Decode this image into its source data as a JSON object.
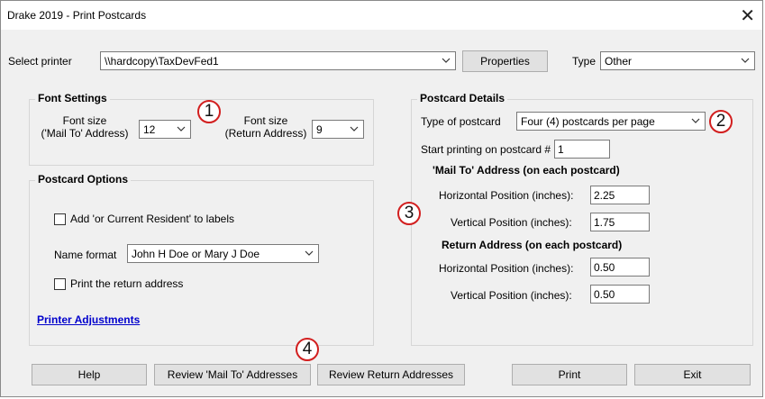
{
  "window": {
    "title": "Drake 2019 - Print Postcards",
    "close_glyph": "✕"
  },
  "printer": {
    "label": "Select printer",
    "value": "\\\\hardcopy\\TaxDevFed1",
    "properties_label": "Properties",
    "type_label": "Type",
    "type_value": "Other"
  },
  "font_settings": {
    "title": "Font Settings",
    "mail_to_label_line1": "Font size",
    "mail_to_label_line2": "('Mail To' Address)",
    "mail_to_value": "12",
    "return_label_line1": "Font size",
    "return_label_line2": "(Return Address)",
    "return_value": "9"
  },
  "postcard_options": {
    "title": "Postcard Options",
    "add_resident_label": "Add 'or Current Resident' to labels",
    "add_resident_checked": false,
    "name_format_label": "Name format",
    "name_format_value": "John H Doe or Mary J Doe",
    "print_return_label": "Print the return address",
    "print_return_checked": false,
    "printer_adjustments_link": "Printer Adjustments"
  },
  "postcard_details": {
    "title": "Postcard Details",
    "type_label": "Type of postcard",
    "type_value": "Four (4) postcards per page",
    "start_label": "Start printing on postcard #",
    "start_value": "1",
    "mail_to_heading": "'Mail To' Address (on each postcard)",
    "mail_to_h_label": "Horizontal Position (inches):",
    "mail_to_h_value": "2.25",
    "mail_to_v_label": "Vertical Position (inches):",
    "mail_to_v_value": "1.75",
    "return_heading": "Return Address (on each postcard)",
    "return_h_label": "Horizontal Position (inches):",
    "return_h_value": "0.50",
    "return_v_label": "Vertical Position (inches):",
    "return_v_value": "0.50"
  },
  "buttons": {
    "help": "Help",
    "review_mail_to": "Review 'Mail To' Addresses",
    "review_return": "Review Return Addresses",
    "print": "Print",
    "exit": "Exit"
  },
  "callouts": [
    "1",
    "2",
    "3",
    "4"
  ],
  "colors": {
    "callout_border": "#d21f1f",
    "link": "#0000cc",
    "dialog_bg": "#f0f0f0"
  }
}
